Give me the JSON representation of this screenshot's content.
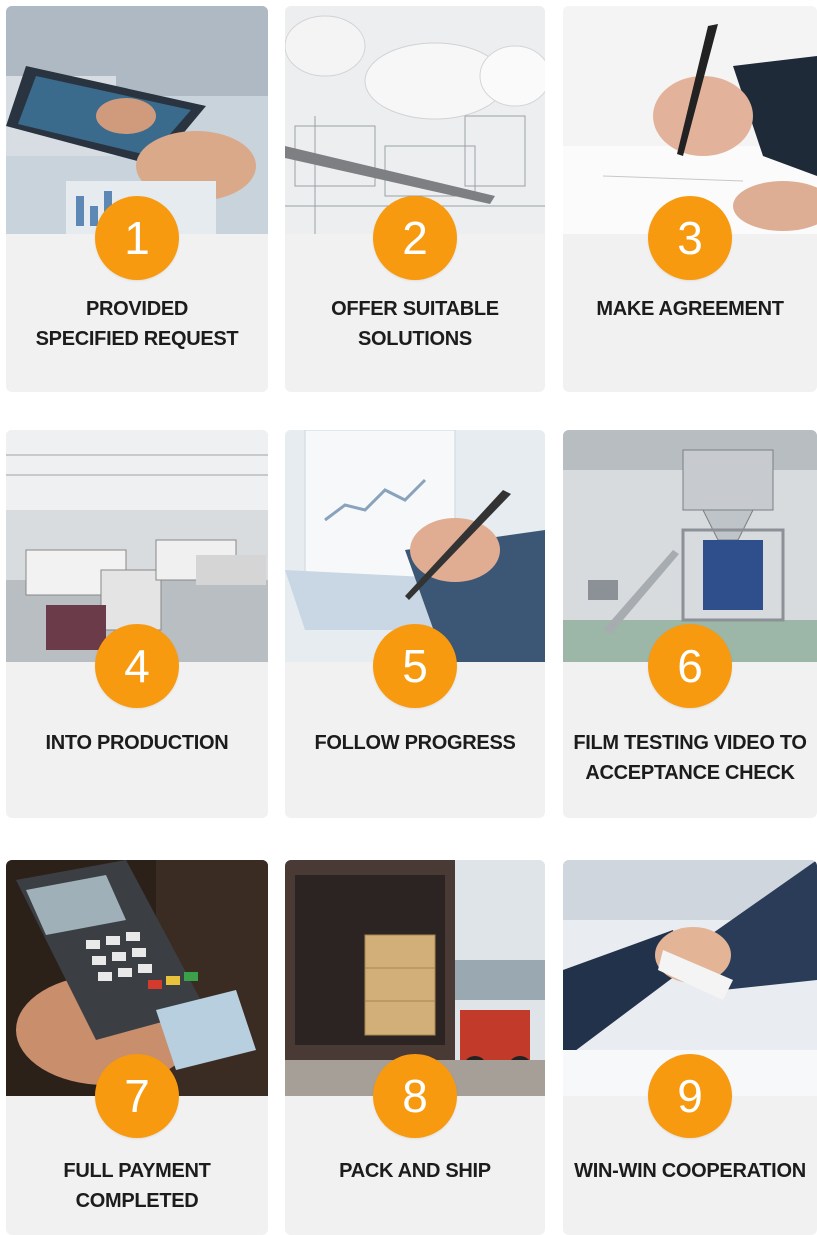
{
  "steps": [
    {
      "number": "1",
      "title": "PROVIDED\nSPECIFIED REQUEST"
    },
    {
      "number": "2",
      "title": "OFFER SUITABLE\nSOLUTIONS"
    },
    {
      "number": "3",
      "title": "MAKE AGREEMENT"
    },
    {
      "number": "4",
      "title": "INTO PRODUCTION"
    },
    {
      "number": "5",
      "title": "FOLLOW PROGRESS"
    },
    {
      "number": "6",
      "title": "FILM TESTING VIDEO TO\nACCEPTANCE CHECK"
    },
    {
      "number": "7",
      "title": "FULL PAYMENT\nCOMPLETED"
    },
    {
      "number": "8",
      "title": "PACK AND SHIP"
    },
    {
      "number": "9",
      "title": "WIN-WIN COOPERATION"
    }
  ],
  "colors": {
    "badge": "#f79a10",
    "card": "#f1f1f1",
    "text": "#1c1c1c"
  }
}
